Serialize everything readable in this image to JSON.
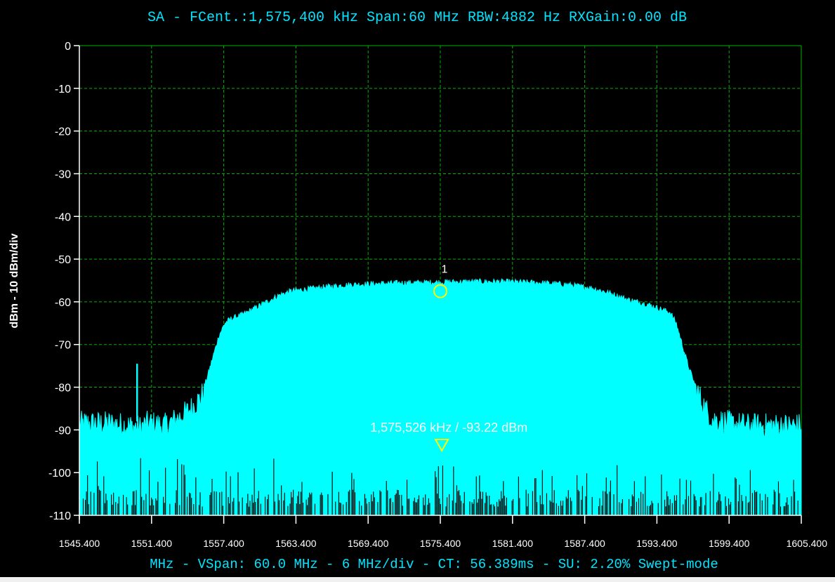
{
  "header": {
    "title": "SA - FCent.:1,575,400 kHz Span:60 MHz RBW:4882 Hz RXGain:0.00 dB"
  },
  "footer": {
    "status": "MHz - VSpan: 60.0 MHz - 6 MHz/div - CT: 56.389ms - SU: 2.20% Swept-mode"
  },
  "colors": {
    "background": "#000000",
    "trace": "#00ffff",
    "grid": "#00b000",
    "axis_text": "#ffffff",
    "header_text": "#00e5ff",
    "marker": "#ffff00"
  },
  "chart_data": {
    "type": "area",
    "title": "SA - FCent.:1,575,400 kHz Span:60 MHz RBW:4882 Hz RXGain:0.00 dB",
    "xlabel": "MHz - VSpan: 60.0 MHz - 6 MHz/div - CT: 56.389ms - SU: 2.20% Swept-mode",
    "ylabel": "dBm - 10 dBm/div",
    "xlim": [
      1545.4,
      1605.4
    ],
    "ylim": [
      -110,
      0
    ],
    "grid": true,
    "x_ticks": [
      "1545.400",
      "1551.400",
      "1557.400",
      "1563.400",
      "1569.400",
      "1575.400",
      "1581.400",
      "1587.400",
      "1593.400",
      "1599.400",
      "1605.400"
    ],
    "y_ticks": [
      "0",
      "-10",
      "-20",
      "-30",
      "-40",
      "-50",
      "-60",
      "-70",
      "-80",
      "-90",
      "-100",
      "-110"
    ],
    "series": [
      {
        "x": [
          1545.4,
          1546.5,
          1548.0,
          1549.5,
          1550.5,
          1551.0,
          1551.5,
          1552.5,
          1553.5,
          1554.5,
          1555.5,
          1556.0,
          1556.5,
          1557.0,
          1557.5,
          1558.0,
          1559.0,
          1560.0,
          1561.0,
          1562.0,
          1563.0,
          1564.5,
          1566.0,
          1568.0,
          1570.0,
          1572.0,
          1574.0,
          1575.4,
          1576.0,
          1578.0,
          1580.0,
          1582.0,
          1584.0,
          1586.0,
          1588.0,
          1589.5,
          1591.0,
          1592.5,
          1593.5,
          1594.5,
          1595.0,
          1595.5,
          1596.0,
          1596.5,
          1597.0,
          1597.5,
          1598.0,
          1599.5,
          1601.0,
          1602.5,
          1604.0,
          1605.4
        ],
        "y": [
          -88,
          -88,
          -88,
          -88.5,
          -89,
          -88,
          -88,
          -88.5,
          -87,
          -85,
          -82,
          -78,
          -73,
          -68,
          -65,
          -64,
          -63,
          -61.5,
          -60,
          -58.5,
          -57.5,
          -57,
          -56.5,
          -56,
          -55.8,
          -55.6,
          -55.5,
          -55.4,
          -55.4,
          -55.3,
          -55.3,
          -55.4,
          -55.6,
          -56,
          -56.8,
          -58,
          -59.5,
          -60.5,
          -61.5,
          -62.5,
          -65,
          -70,
          -75,
          -79,
          -82,
          -85,
          -87,
          -88,
          -88.5,
          -88.5,
          -88.5,
          -88.5
        ]
      }
    ],
    "spike": {
      "x": 1550.2,
      "y": -74.5
    },
    "noise_floor": -110,
    "markers": [
      {
        "label": "1",
        "x": 1575.4,
        "y": -57.5,
        "shape": "circle"
      },
      {
        "label": "1,575,526 kHz / -93.22 dBm",
        "x": 1575.526,
        "y": -93.22,
        "shape": "triangle"
      }
    ]
  }
}
